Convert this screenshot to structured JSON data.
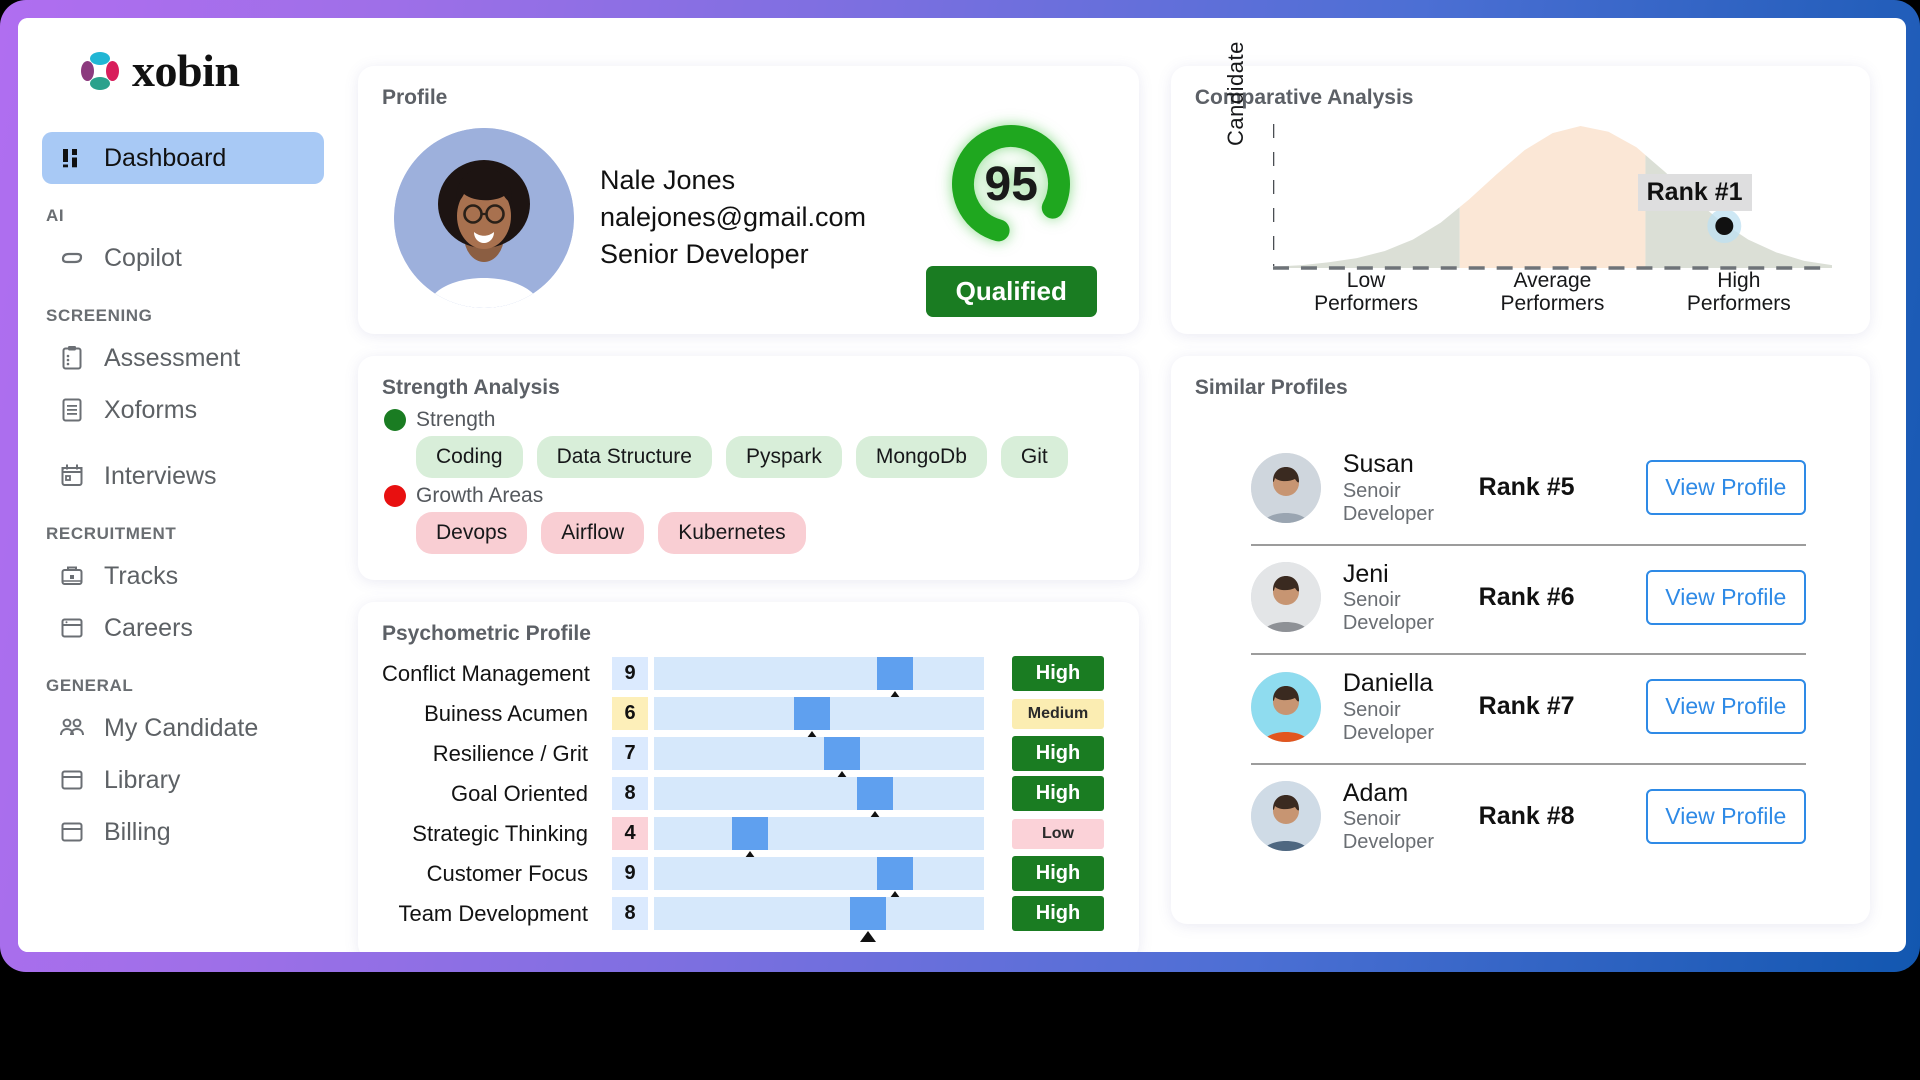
{
  "brand": {
    "name": "xobin"
  },
  "sidebar": {
    "items": [
      {
        "label": "Dashboard",
        "icon": "dashboard-icon",
        "active": true
      },
      {
        "section": "AI"
      },
      {
        "label": "Copilot",
        "icon": "copilot-icon",
        "active": false
      },
      {
        "section": "SCREENING"
      },
      {
        "label": "Assessment",
        "icon": "clipboard-icon",
        "active": false
      },
      {
        "label": "Xoforms",
        "icon": "document-icon",
        "active": false
      },
      {
        "label": "Interviews",
        "icon": "calendar-icon",
        "active": false
      },
      {
        "section": "RECRUITMENT"
      },
      {
        "label": "Tracks",
        "icon": "briefcase-icon",
        "active": false
      },
      {
        "label": "Careers",
        "icon": "window-icon",
        "active": false
      },
      {
        "section": "GENERAL"
      },
      {
        "label": "My Candidate",
        "icon": "people-icon",
        "active": false
      },
      {
        "label": "Library",
        "icon": "library-icon",
        "active": false
      },
      {
        "label": "Billing",
        "icon": "billing-icon",
        "active": false
      }
    ]
  },
  "profile": {
    "title": "Profile",
    "name": "Nale Jones",
    "email": "nalejones@gmail.com",
    "role": "Senior Developer",
    "score": "95",
    "score_percent": 79,
    "status_label": "Qualified",
    "status_color": "#1a7c22"
  },
  "strength": {
    "title": "Strength Analysis",
    "strength_label": "Strength",
    "strength_color": "#1a7c22",
    "strength_chips": [
      "Coding",
      "Data Structure",
      "Pyspark",
      "MongoDb",
      "Git"
    ],
    "growth_label": "Growth Areas",
    "growth_color": "#e81010",
    "growth_chips": [
      "Devops",
      "Airflow",
      "Kubernetes"
    ]
  },
  "psychometric": {
    "title": "Psychometric Profile",
    "rows": [
      {
        "trait": "Conflict Management",
        "score": "9",
        "level": "high",
        "tag": "High",
        "pos": 73
      },
      {
        "trait": "Buiness Acumen",
        "score": "6",
        "level": "medium",
        "tag": "Medium",
        "pos": 48
      },
      {
        "trait": "Resilience / Grit",
        "score": "7",
        "level": "high",
        "tag": "High",
        "pos": 57
      },
      {
        "trait": "Goal Oriented",
        "score": "8",
        "level": "high",
        "tag": "High",
        "pos": 67
      },
      {
        "trait": "Strategic Thinking",
        "score": "4",
        "level": "low",
        "tag": "Low",
        "pos": 29
      },
      {
        "trait": "Customer Focus",
        "score": "9",
        "level": "high",
        "tag": "High",
        "pos": 73
      },
      {
        "trait": "Team Development",
        "score": "8",
        "level": "high",
        "tag": "High",
        "pos": 65
      }
    ]
  },
  "comparative": {
    "title": "Comparative Analysis",
    "y_axis_label": "Candidate",
    "rank_label": "Rank #1",
    "categories": [
      "Low\nPerformers",
      "Average\nPerformers",
      "High\nPerformers"
    ],
    "cat_low_line1": "Low",
    "cat_low_line2": "Performers",
    "cat_avg_line1": "Average",
    "cat_avg_line2": "Performers",
    "cat_high_line1": "High",
    "cat_high_line2": "Performers"
  },
  "chart_data": {
    "type": "area",
    "title": "Comparative Analysis",
    "xlabel": "",
    "ylabel": "Candidate",
    "categories": [
      "Low Performers",
      "Average Performers",
      "High Performers"
    ],
    "distribution": "normal bell curve",
    "bands": [
      {
        "name": "Low Performers",
        "fill": "#dbdfd6",
        "x_range": [
          0,
          33
        ]
      },
      {
        "name": "Average Performers",
        "fill": "#fbe7d6",
        "x_range": [
          33,
          67
        ]
      },
      {
        "name": "High Performers",
        "fill": "#dbdfd6",
        "x_range": [
          67,
          100
        ]
      }
    ],
    "x": [
      0,
      5,
      10,
      15,
      20,
      25,
      30,
      35,
      40,
      45,
      50,
      55,
      60,
      65,
      70,
      75,
      80,
      85,
      90,
      95,
      100
    ],
    "y": [
      1,
      2,
      4,
      7,
      12,
      20,
      32,
      48,
      66,
      83,
      95,
      100,
      96,
      85,
      68,
      50,
      33,
      20,
      11,
      5,
      2
    ],
    "annotation": {
      "label": "Rank #1",
      "x": 82,
      "y": 26,
      "marker_color": "#111111"
    },
    "grid": false,
    "legend": "none"
  },
  "similar": {
    "title": "Similar Profiles",
    "button_label": "View Profile",
    "rows": [
      {
        "name": "Susan",
        "role": "Senoir Developer",
        "rank": "Rank #5",
        "av1": "#cfd6dd",
        "av2": "#9aa5b1"
      },
      {
        "name": "Jeni",
        "role": "Senoir Developer",
        "rank": "Rank #6",
        "av1": "#e3e5e7",
        "av2": "#8e9196"
      },
      {
        "name": "Daniella",
        "role": "Senoir Developer",
        "rank": "Rank #7",
        "av1": "#8fdcef",
        "av2": "#e2561f"
      },
      {
        "name": "Adam",
        "role": "Senoir Developer",
        "rank": "Rank #8",
        "av1": "#cfdbe6",
        "av2": "#4e6780"
      }
    ]
  }
}
